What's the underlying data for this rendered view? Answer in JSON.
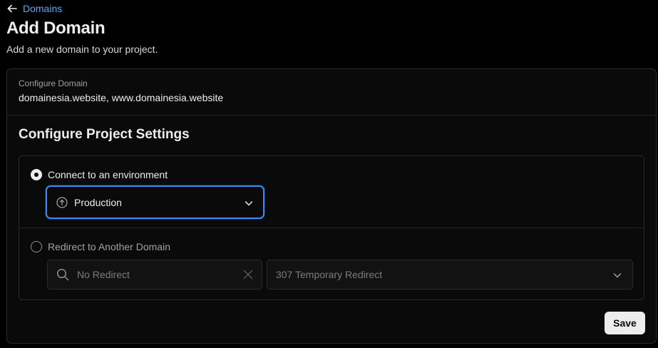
{
  "nav": {
    "back_label": "Domains"
  },
  "header": {
    "title": "Add Domain",
    "subtitle": "Add a new domain to your project."
  },
  "configure_domain": {
    "label": "Configure Domain",
    "value": "domainesia.website, www.domainesia.website"
  },
  "project_settings": {
    "title": "Configure Project Settings",
    "environment_option": {
      "label": "Connect to an environment",
      "selected": true,
      "select_value": "Production",
      "icon": "arrow-up-circle-icon"
    },
    "redirect_option": {
      "label": "Redirect to Another Domain",
      "selected": false,
      "search_placeholder": "No Redirect",
      "redirect_type": "307 Temporary Redirect"
    }
  },
  "actions": {
    "save_label": "Save"
  },
  "colors": {
    "accent": "#3f86f0",
    "link": "#52a8ff",
    "background": "#000000",
    "card": "#0a0a0a",
    "border": "#2b2b2b"
  }
}
